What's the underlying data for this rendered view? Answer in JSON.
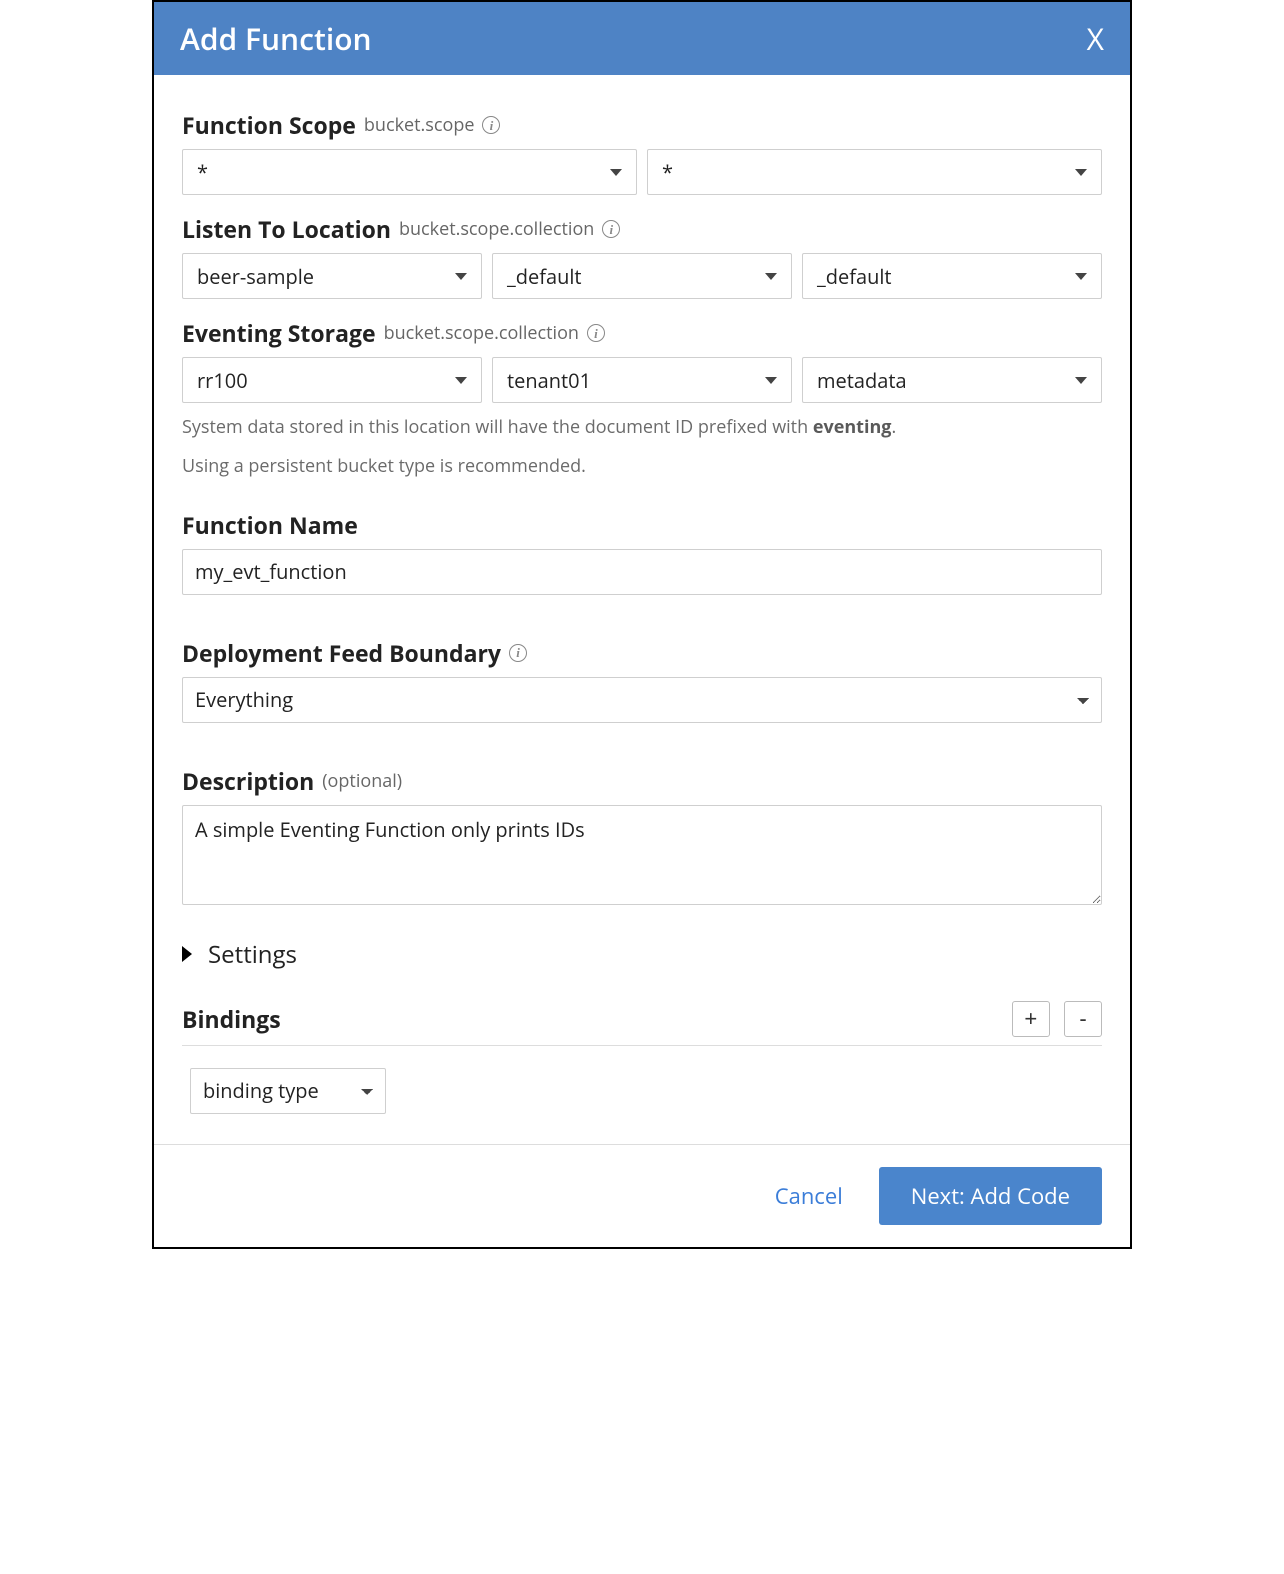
{
  "dialog": {
    "title": "Add Function",
    "close": "X"
  },
  "scope": {
    "label": "Function Scope",
    "sub": "bucket.scope",
    "bucket": "*",
    "scope": "*"
  },
  "listen": {
    "label": "Listen To Location",
    "sub": "bucket.scope.collection",
    "bucket": "beer-sample",
    "scope": "_default",
    "collection": "_default"
  },
  "storage": {
    "label": "Eventing Storage",
    "sub": "bucket.scope.collection",
    "bucket": "rr100",
    "scope": "tenant01",
    "collection": "metadata",
    "help1_a": "System data stored in this location will have the document ID prefixed with ",
    "help1_b": "eventing",
    "help1_c": ".",
    "help2": "Using a persistent bucket type is recommended."
  },
  "name": {
    "label": "Function Name",
    "value": "my_evt_function"
  },
  "feed": {
    "label": "Deployment Feed Boundary",
    "value": "Everything"
  },
  "desc": {
    "label": "Description",
    "optional": "(optional)",
    "value": "A simple Eventing Function only prints IDs"
  },
  "settings": {
    "label": "Settings"
  },
  "bindings": {
    "label": "Bindings",
    "add": "+",
    "remove": "-",
    "type_placeholder": "binding type"
  },
  "footer": {
    "cancel": "Cancel",
    "next": "Next: Add Code"
  }
}
